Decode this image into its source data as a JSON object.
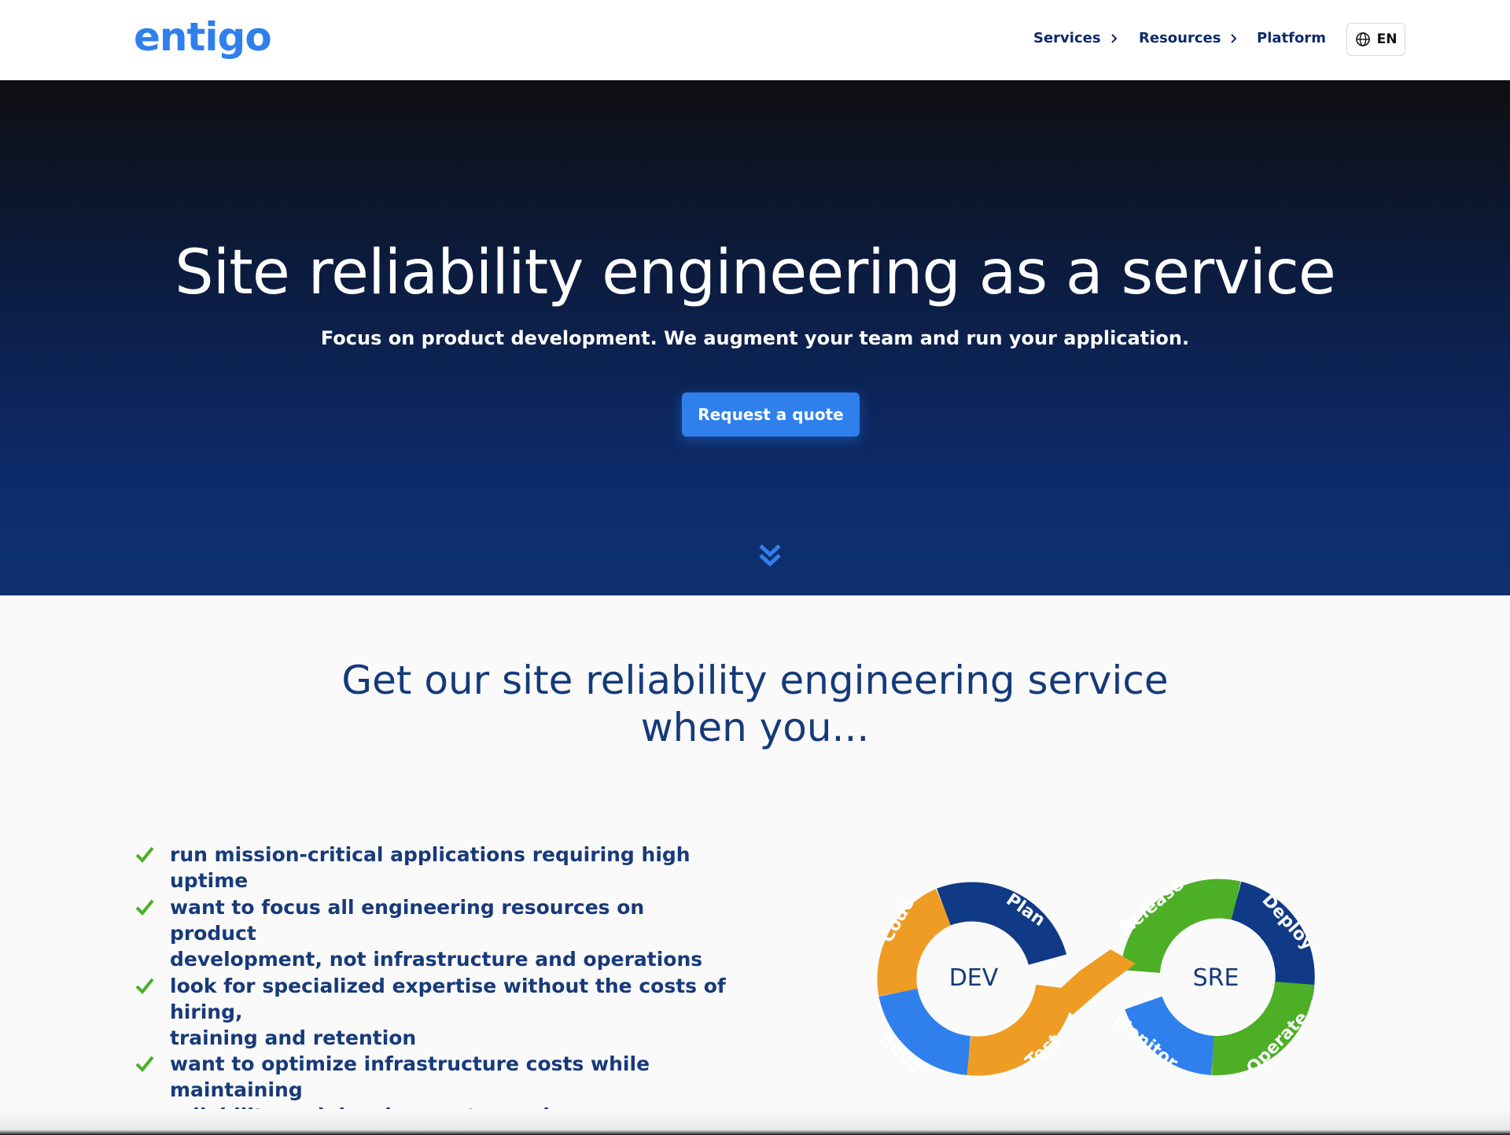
{
  "header": {
    "logo": "entigo",
    "nav": [
      {
        "label": "Services",
        "has_chevron": true
      },
      {
        "label": "Resources",
        "has_chevron": true
      },
      {
        "label": "Platform",
        "has_chevron": false
      }
    ],
    "language": "EN"
  },
  "hero": {
    "title": "Site reliability engineering as a service",
    "subtitle": "Focus on product development. We augment your team and run your application.",
    "cta_label": "Request a quote"
  },
  "section": {
    "title_line1": "Get our site reliability engineering service",
    "title_line2": "when you...",
    "items": [
      {
        "line1": "run mission-critical applications requiring high uptime",
        "line2": ""
      },
      {
        "line1": "want to focus all engineering resources on product",
        "line2": "development, not infrastructure and operations"
      },
      {
        "line1": "look for specialized expertise without the costs of hiring,",
        "line2": "training and retention"
      },
      {
        "line1": "want to optimize infrastructure costs while maintaining",
        "line2": "reliability and development speed"
      }
    ]
  },
  "diagram": {
    "left_label": "DEV",
    "right_label": "SRE",
    "segments": [
      "Code",
      "Plan",
      "Build",
      "Test",
      "Release",
      "Deploy",
      "Monitor",
      "Operate"
    ],
    "colors": {
      "orange": "#ee9c24",
      "navy": "#103a86",
      "blue": "#2f80ed",
      "green": "#4caf25"
    }
  },
  "colors": {
    "accent": "#2f80ed",
    "navy_text": "#153a7a",
    "check": "#4caf25"
  }
}
